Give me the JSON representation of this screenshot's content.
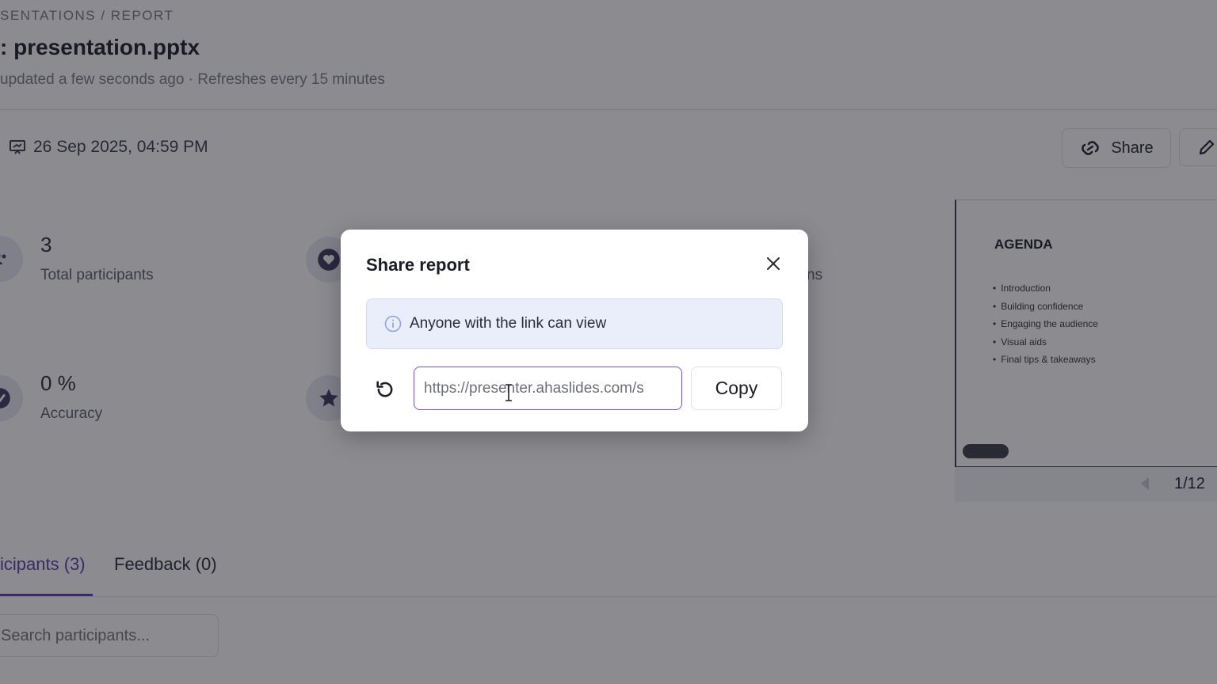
{
  "header": {
    "breadcrumb": "SENTATIONS  /  REPORT",
    "title": ": presentation.pptx",
    "update_text": "updated a few seconds ago · Refreshes every 15 minutes",
    "date": "26 Sep 2025, 04:59 PM"
  },
  "actions": {
    "share_label": "Share"
  },
  "stats": {
    "participants_value": "3",
    "participants_label": "Total participants",
    "accuracy_value": "0 %",
    "accuracy_label": "Accuracy",
    "partial_label": "ns"
  },
  "slide_preview": {
    "title": "AGENDA",
    "items": [
      "Introduction",
      "Building confidence",
      "Engaging the audience",
      "Visual aids",
      "Final tips & takeaways"
    ],
    "counter": "1/12"
  },
  "tabs": {
    "participants": "icipants (3)",
    "feedback": "Feedback (0)"
  },
  "search": {
    "placeholder": "Search participants..."
  },
  "modal": {
    "title": "Share report",
    "info": "Anyone with the link can view",
    "link_value": "https://presenter.ahaslides.com/s",
    "copy_label": "Copy"
  },
  "colors": {
    "accent": "#5a3fa8",
    "input_border": "#7a53c8",
    "info_bg": "#eaeefb"
  }
}
